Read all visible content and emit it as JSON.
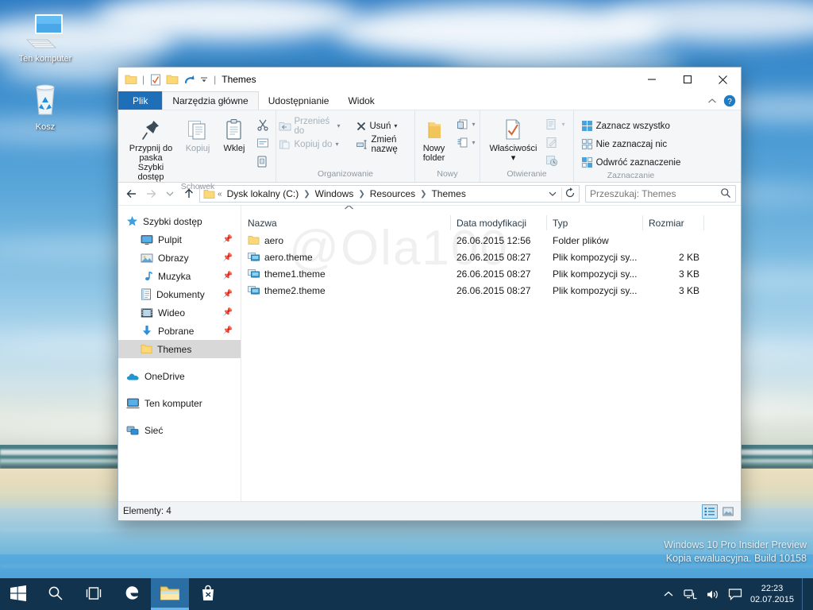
{
  "desktop": {
    "icons": [
      {
        "label": "Ten komputer",
        "icon": "computer-icon"
      },
      {
        "label": "Kosz",
        "icon": "recycle-bin-icon"
      }
    ],
    "watermark_line1": "Windows 10 Pro Insider Preview",
    "watermark_line2": "Kopia ewaluacyjna. Build 10158"
  },
  "window": {
    "title": "Themes",
    "quick_access": [
      "folder-icon",
      "properties-check-icon",
      "new-folder-icon",
      "redo-icon",
      "customize-caret-icon"
    ],
    "controls": {
      "minimize": "−",
      "maximize": "☐",
      "close": "✕"
    },
    "help_icon": "help-icon",
    "collapse_icon": "collapse-ribbon-icon"
  },
  "tabs": [
    {
      "label": "Plik",
      "state": "file"
    },
    {
      "label": "Narzędzia główne",
      "state": "active"
    },
    {
      "label": "Udostępnianie",
      "state": "normal"
    },
    {
      "label": "Widok",
      "state": "normal"
    }
  ],
  "ribbon": {
    "groups": [
      {
        "name": "Schowek",
        "label": "Schowek",
        "big_buttons": [
          {
            "label_line1": "Przypnij do paska",
            "label_line2": "Szybki dostęp",
            "icon": "pin-icon",
            "disabled": false
          },
          {
            "label_line1": "Kopiuj",
            "label_line2": "",
            "icon": "copy-icon",
            "disabled": true
          },
          {
            "label_line1": "Wklej",
            "label_line2": "",
            "icon": "paste-icon",
            "disabled": false
          }
        ],
        "small_buttons": [
          {
            "label": "",
            "icon": "cut-icon"
          },
          {
            "label": "",
            "icon": "copy-path-icon"
          },
          {
            "label": "",
            "icon": "paste-shortcut-icon"
          }
        ]
      },
      {
        "name": "Organizowanie",
        "label": "Organizowanie",
        "small_buttons": [
          {
            "label": "Przenieś do",
            "icon": "move-to-icon",
            "caret": true,
            "disabled": true
          },
          {
            "label": "Kopiuj do",
            "icon": "copy-to-icon",
            "caret": true,
            "disabled": true
          },
          {
            "label": "Usuń",
            "icon": "delete-icon",
            "caret": true,
            "disabled": false
          },
          {
            "label": "Zmień nazwę",
            "icon": "rename-icon",
            "caret": false,
            "disabled": false
          }
        ]
      },
      {
        "name": "Nowy",
        "label": "Nowy",
        "big_buttons": [
          {
            "label_line1": "Nowy",
            "label_line2": "folder",
            "icon": "new-folder-big-icon",
            "disabled": false
          }
        ],
        "small_buttons": [
          {
            "label": "",
            "icon": "new-item-icon",
            "caret": true
          },
          {
            "label": "",
            "icon": "easy-access-icon",
            "caret": true
          }
        ]
      },
      {
        "name": "Otwieranie",
        "label": "Otwieranie",
        "big_buttons": [
          {
            "label_line1": "Właściwości",
            "label_line2": "▾",
            "icon": "properties-icon",
            "disabled": false
          }
        ],
        "small_buttons": [
          {
            "label": "",
            "icon": "open-icon",
            "caret": true
          },
          {
            "label": "",
            "icon": "edit-icon",
            "caret": false
          },
          {
            "label": "",
            "icon": "history-icon",
            "caret": false
          }
        ]
      },
      {
        "name": "Zaznaczanie",
        "label": "Zaznaczanie",
        "small_buttons": [
          {
            "label": "Zaznacz wszystko",
            "icon": "select-all-icon",
            "caret": false,
            "disabled": false
          },
          {
            "label": "Nie zaznaczaj nic",
            "icon": "select-none-icon",
            "caret": false,
            "disabled": false
          },
          {
            "label": "Odwróć zaznaczenie",
            "icon": "invert-selection-icon",
            "caret": false,
            "disabled": false
          }
        ]
      }
    ]
  },
  "address_bar": {
    "back_icon": "back-arrow-icon",
    "forward_icon": "forward-arrow-icon",
    "recent_icon": "recent-locations-icon",
    "up_icon": "up-arrow-icon",
    "folder_icon": "folder-icon",
    "overflow": "«",
    "crumbs": [
      "Dysk lokalny (C:)",
      "Windows",
      "Resources",
      "Themes"
    ],
    "dropdown_icon": "chevron-down-icon",
    "refresh_icon": "refresh-icon",
    "search_placeholder": "Przeszukaj: Themes",
    "search_value": "",
    "search_icon": "search-icon"
  },
  "nav_pane": {
    "sections": [
      {
        "header": {
          "label": "Szybki dostęp",
          "icon": "star-icon"
        },
        "items": [
          {
            "label": "Pulpit",
            "icon": "desktop-icon",
            "pinned": true,
            "selected": false
          },
          {
            "label": "Obrazy",
            "icon": "pictures-icon",
            "pinned": true,
            "selected": false
          },
          {
            "label": "Muzyka",
            "icon": "music-icon",
            "pinned": true,
            "selected": false
          },
          {
            "label": "Dokumenty",
            "icon": "documents-icon",
            "pinned": true,
            "selected": false
          },
          {
            "label": "Wideo",
            "icon": "video-icon",
            "pinned": true,
            "selected": false
          },
          {
            "label": "Pobrane",
            "icon": "downloads-icon",
            "pinned": true,
            "selected": false
          },
          {
            "label": "Themes",
            "icon": "folder-icon",
            "pinned": false,
            "selected": true
          }
        ]
      },
      {
        "header": {
          "label": "OneDrive",
          "icon": "onedrive-icon"
        },
        "items": []
      },
      {
        "header": {
          "label": "Ten komputer",
          "icon": "computer-icon"
        },
        "items": []
      },
      {
        "header": {
          "label": "Sieć",
          "icon": "network-icon"
        },
        "items": []
      }
    ]
  },
  "file_list": {
    "sort_indicator": "ascending",
    "columns": [
      {
        "label": "Nazwa",
        "key": "name"
      },
      {
        "label": "Data modyfikacji",
        "key": "modified"
      },
      {
        "label": "Typ",
        "key": "type"
      },
      {
        "label": "Rozmiar",
        "key": "size"
      }
    ],
    "rows": [
      {
        "name": "aero",
        "modified": "26.06.2015 12:56",
        "type": "Folder plików",
        "size": "",
        "icon": "folder-icon"
      },
      {
        "name": "aero.theme",
        "modified": "26.06.2015 08:27",
        "type": "Plik kompozycji sy...",
        "size": "2 KB",
        "icon": "theme-file-icon"
      },
      {
        "name": "theme1.theme",
        "modified": "26.06.2015 08:27",
        "type": "Plik kompozycji sy...",
        "size": "3 KB",
        "icon": "theme-file-icon"
      },
      {
        "name": "theme2.theme",
        "modified": "26.06.2015 08:27",
        "type": "Plik kompozycji sy...",
        "size": "3 KB",
        "icon": "theme-file-icon"
      }
    ],
    "watermark": "@Ola100"
  },
  "status_bar": {
    "items_text": "Elementy: 4",
    "view_buttons": [
      {
        "icon": "details-view-icon",
        "active": true
      },
      {
        "icon": "large-icons-view-icon",
        "active": false
      }
    ]
  },
  "taskbar": {
    "buttons": [
      {
        "name": "start-button",
        "icon": "windows-logo-icon",
        "active": false
      },
      {
        "name": "search-button",
        "icon": "search-icon",
        "active": false
      },
      {
        "name": "task-view-button",
        "icon": "task-view-icon",
        "active": false
      },
      {
        "name": "edge-button",
        "icon": "edge-icon",
        "active": false
      },
      {
        "name": "file-explorer-button",
        "icon": "folder-icon",
        "active": true
      },
      {
        "name": "store-button",
        "icon": "store-icon",
        "active": false
      }
    ],
    "tray": [
      "show-hidden-icons-icon",
      "network-icon",
      "volume-icon",
      "action-center-icon"
    ],
    "clock_time": "22:23",
    "clock_date": "02.07.2015"
  }
}
